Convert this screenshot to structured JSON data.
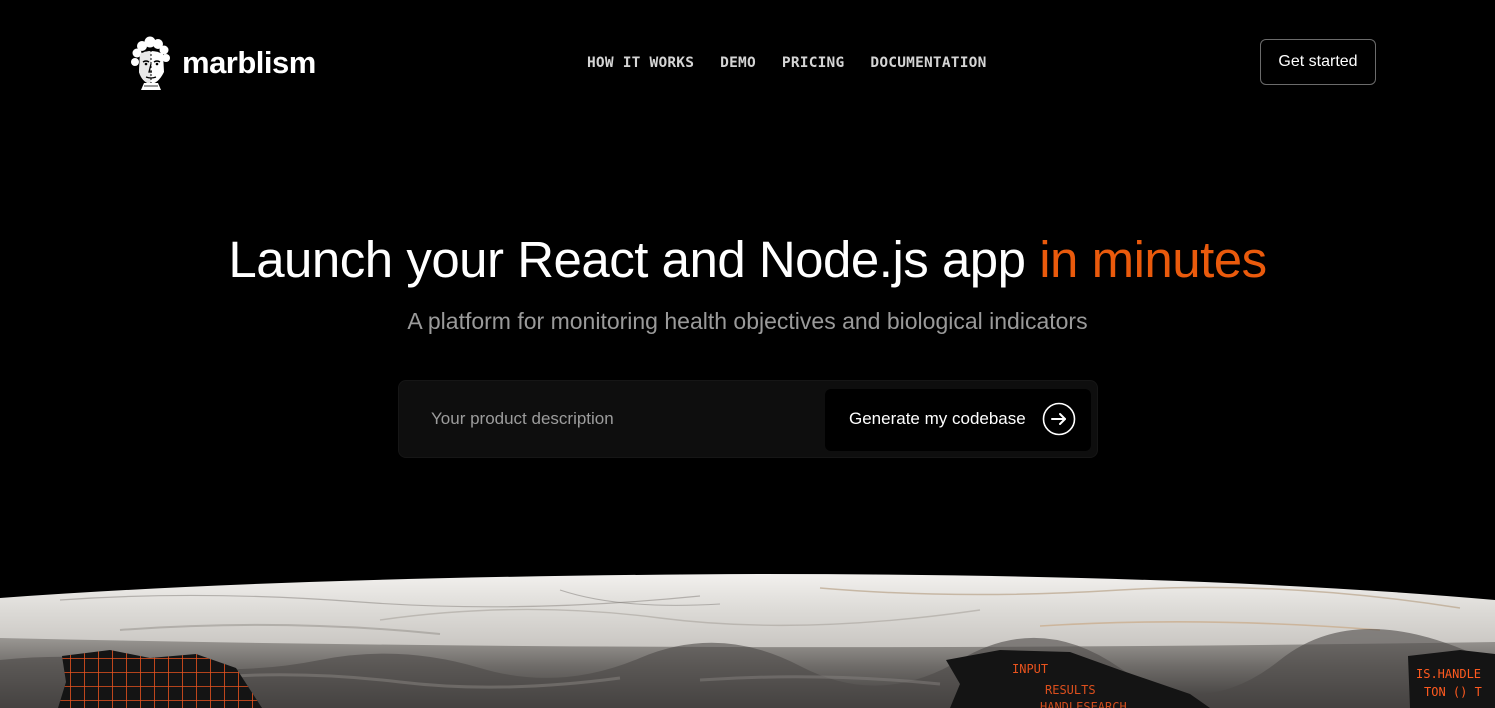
{
  "brand": {
    "name": "marblism",
    "logo_icon": "marble-bust-icon"
  },
  "nav": {
    "items": [
      {
        "label": "HOW IT WORKS"
      },
      {
        "label": "DEMO"
      },
      {
        "label": "PRICING"
      },
      {
        "label": "DOCUMENTATION"
      }
    ]
  },
  "header": {
    "cta_label": "Get started"
  },
  "hero": {
    "title_main": "Launch your React and Node.js app ",
    "title_accent": "in minutes",
    "subtitle": "A platform for monitoring health objectives and biological indicators"
  },
  "prompt": {
    "placeholder": "Your product description",
    "value": "",
    "button_label": "Generate my codebase",
    "button_icon": "arrow-right-circle-icon"
  },
  "slab_code_text": [
    "INPUT",
    "RESULTS",
    "HANDLESEARCH",
    "IS.HANDLE",
    "TON () T"
  ],
  "colors": {
    "background": "#000000",
    "accent": "#ea5a0c",
    "nav_text": "#d4d4d4",
    "subtitle": "#9a9a9a",
    "input_bg": "#0e0e0e",
    "code_glow": "#ff5a1f"
  }
}
